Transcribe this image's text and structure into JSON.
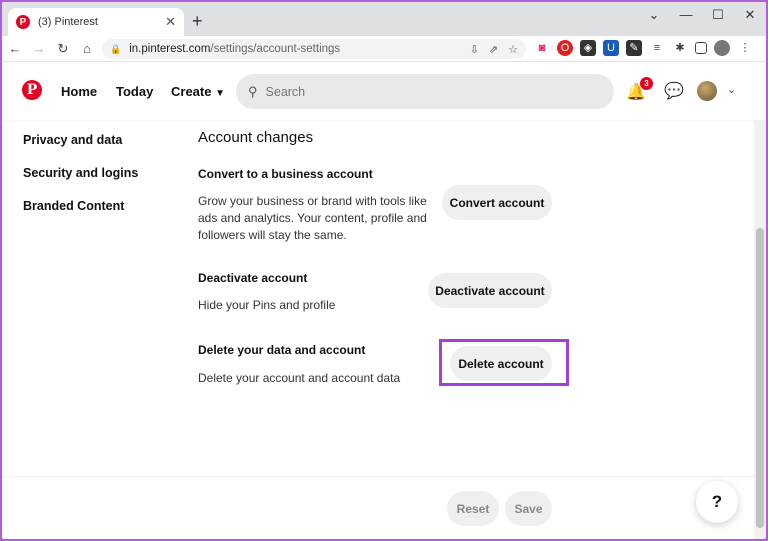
{
  "browser": {
    "tab_title": "(3) Pinterest",
    "tab_favicon": "P",
    "tab_close": "✕",
    "new_tab": "+",
    "url_host": "in.pinterest.com",
    "url_path": "/settings/account-settings"
  },
  "header": {
    "logo": "P",
    "nav": [
      "Home",
      "Today",
      "Create"
    ],
    "search_placeholder": "Search",
    "notification_count": "3"
  },
  "sidebar": {
    "items": [
      "Privacy and data",
      "Security and logins",
      "Branded Content"
    ]
  },
  "main": {
    "section_title": "Account changes",
    "convert": {
      "title": "Convert to a business account",
      "description_lines": [
        "Grow your business or brand with tools like",
        "ads and analytics. Your content, profile and",
        "followers will stay the same."
      ],
      "button": "Convert account"
    },
    "deactivate": {
      "title": "Deactivate account",
      "description": "Hide your Pins and profile",
      "button": "Deactivate account"
    },
    "delete": {
      "title": "Delete your data and account",
      "description": "Delete your account and account data",
      "button": "Delete account"
    }
  },
  "footer": {
    "reset": "Reset",
    "save": "Save",
    "help": "?"
  },
  "colors": {
    "brand": "#e60023",
    "highlight": "#a43fd9",
    "outer_frame": "#b05fd6"
  }
}
